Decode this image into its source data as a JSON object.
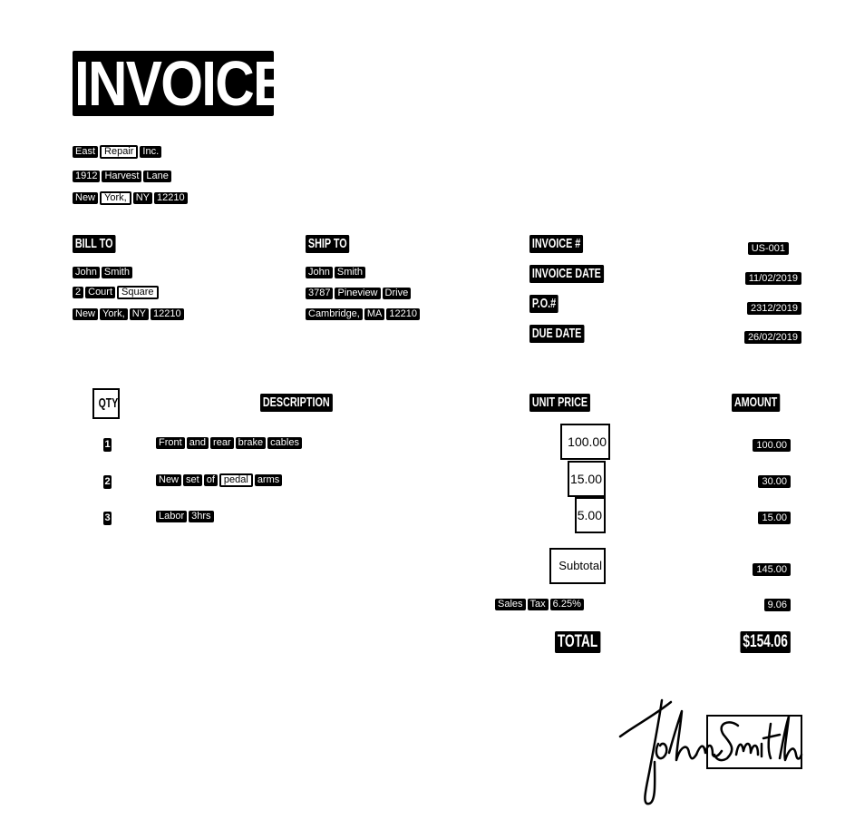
{
  "title": "INVOICE",
  "company": {
    "line1": [
      "East",
      "Repair",
      "Inc."
    ],
    "line2": [
      "1912",
      "Harvest",
      "Lane"
    ],
    "line3": [
      "New",
      "York,",
      "NY",
      "12210"
    ]
  },
  "bill_to": {
    "heading": "BILL TO",
    "name": [
      "John",
      "Smith"
    ],
    "street": [
      "2",
      "Court",
      "Square"
    ],
    "city": [
      "New",
      "York,",
      "NY",
      "12210"
    ]
  },
  "ship_to": {
    "heading": "SHIP TO",
    "name": [
      "John",
      "Smith"
    ],
    "street": [
      "3787",
      "Pineview",
      "Drive"
    ],
    "city": [
      "Cambridge,",
      "MA",
      "12210"
    ]
  },
  "meta": {
    "invoice_no_label": "INVOICE #",
    "invoice_no": "US-001",
    "invoice_date_label": "INVOICE DATE",
    "invoice_date": "11/02/2019",
    "po_label": "P.O.#",
    "po": "2312/2019",
    "due_date_label": "DUE DATE",
    "due_date": "26/02/2019"
  },
  "table": {
    "headers": {
      "qty": "QTY",
      "description": "DESCRIPTION",
      "unit_price": "UNIT PRICE",
      "amount": "AMOUNT"
    },
    "rows": [
      {
        "qty": "1",
        "description": [
          "Front",
          "and",
          "rear",
          "brake",
          "cables"
        ],
        "unit_price": "100.00",
        "amount": "100.00"
      },
      {
        "qty": "2",
        "description": [
          "New",
          "set",
          "of",
          "pedal",
          "arms"
        ],
        "unit_price": "15.00",
        "amount": "30.00"
      },
      {
        "qty": "3",
        "description": [
          "Labor",
          "3hrs"
        ],
        "unit_price": "5.00",
        "amount": "15.00"
      }
    ]
  },
  "totals": {
    "subtotal_label": "Subtotal",
    "subtotal": "145.00",
    "tax_label": [
      "Sales",
      "Tax",
      "6.25%"
    ],
    "tax": "9.06",
    "total_label": "TOTAL",
    "total": "$154.06"
  },
  "signature": {
    "first": "John",
    "last": "Smith"
  }
}
